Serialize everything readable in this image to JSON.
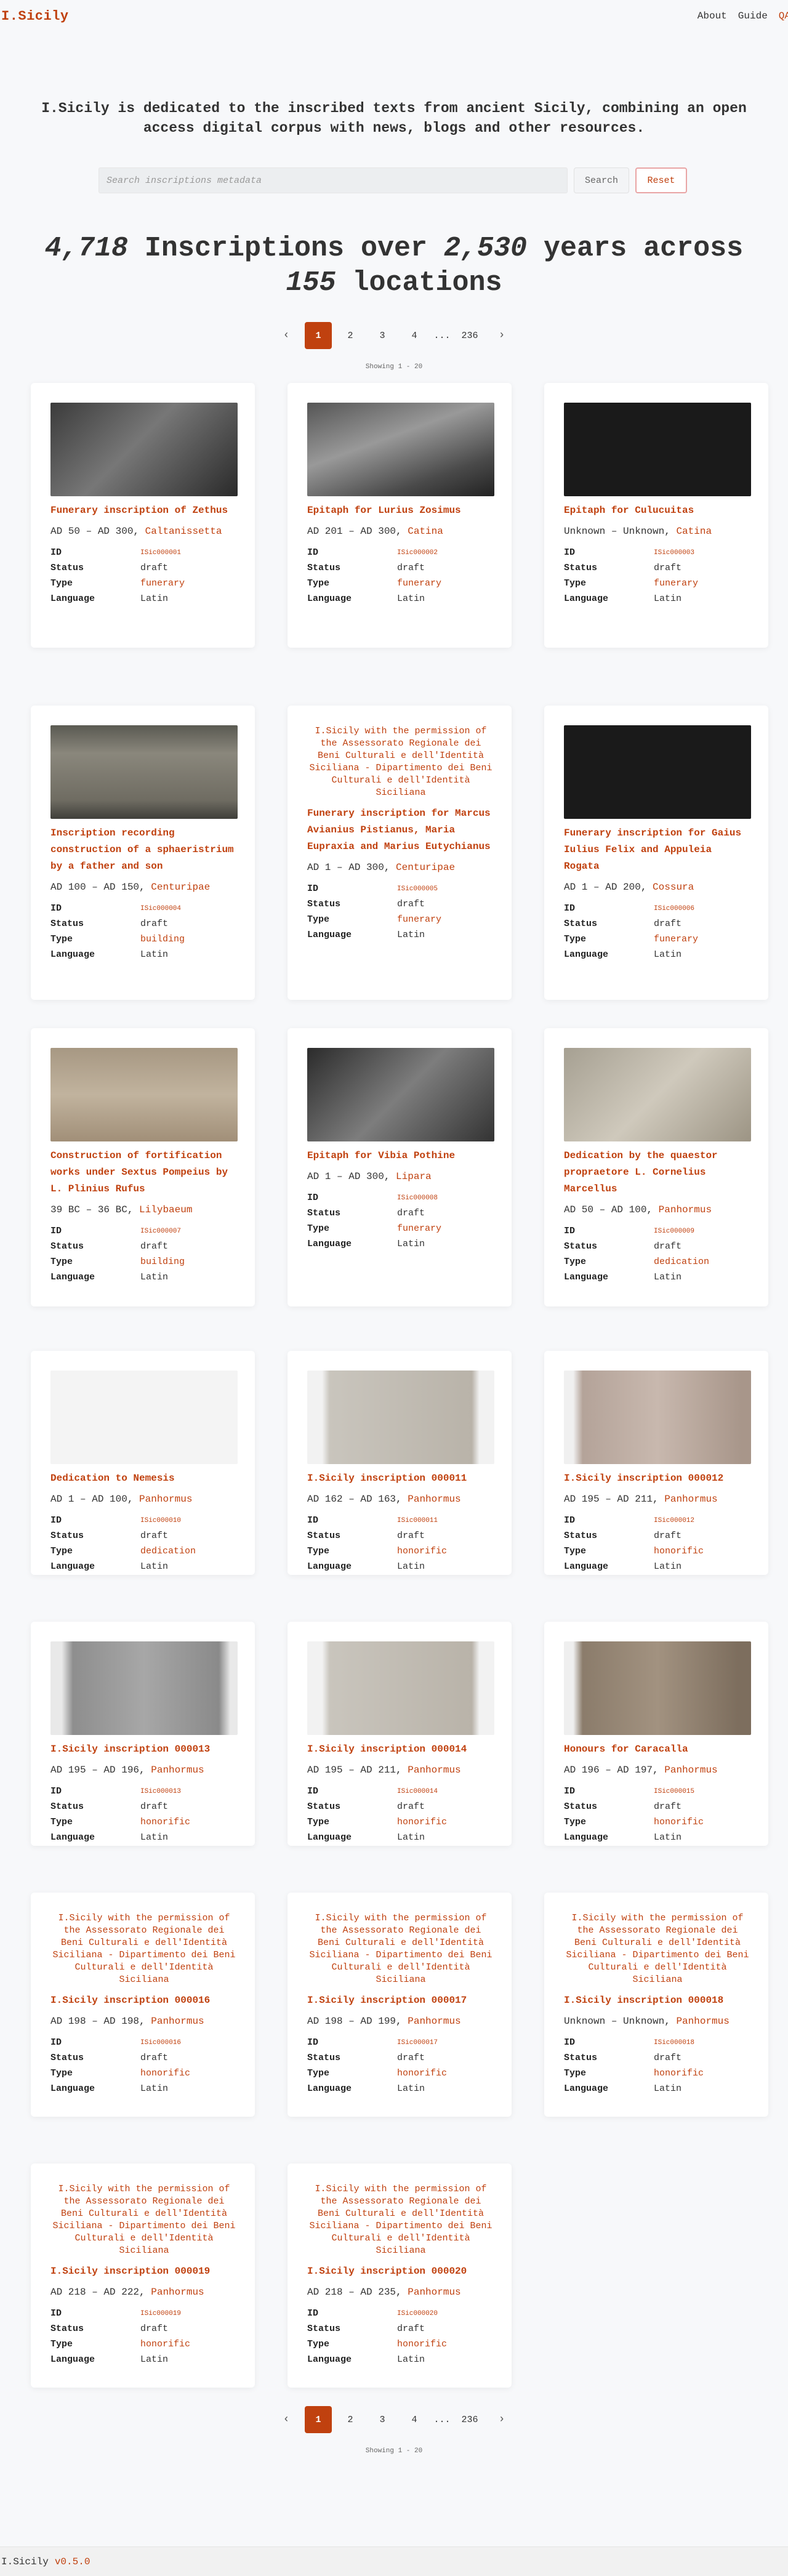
{
  "header": {
    "brand": "I.Sicily",
    "nav": {
      "about": "About",
      "guide": "Guide",
      "qa": "QA"
    }
  },
  "intro": "I.Sicily is dedicated to the inscribed texts from ancient Sicily, combining an open access digital corpus with news, blogs and other resources.",
  "search": {
    "placeholder": "Search inscriptions metadata",
    "search_label": "Search",
    "reset_label": "Reset"
  },
  "headline": {
    "count": "4,718",
    "middle": " Inscriptions over ",
    "years": "2,530",
    "middle2": " years across ",
    "locations": "155",
    "end": " locations"
  },
  "pagination": {
    "prev": "‹",
    "next": "›",
    "pages": [
      "1",
      "2",
      "3",
      "4"
    ],
    "dots": "...",
    "last": "236",
    "showing": "Showing 1 - 20"
  },
  "labels": {
    "id": "ID",
    "status": "Status",
    "type": "Type",
    "language": "Language"
  },
  "alt_text": "I.Sicily with the permission of the Assessorato Regionale dei Beni Culturali e dell'Identità Siciliana - Dipartimento dei Beni Culturali e dell'Identità Siciliana",
  "cards": [
    {
      "title": "Funerary inscription of Zethus",
      "date": "AD 50 – AD 300,",
      "place": "Caltanissetta",
      "id": "ISic000001",
      "status": "draft",
      "type": "funerary",
      "language": "Latin",
      "image": "stone-dark-letters"
    },
    {
      "title": "Epitaph for Lurius Zosimus",
      "date": "AD 201 – AD 300,",
      "place": "Catina",
      "id": "ISic000002",
      "status": "draft",
      "type": "funerary",
      "language": "Latin",
      "image": "stone-dark-gray"
    },
    {
      "title": "Epitaph for Culucuitas",
      "date": "Unknown – Unknown,",
      "place": "Catina",
      "id": "ISic000003",
      "status": "draft",
      "type": "funerary",
      "language": "Latin",
      "image": "stone-white-on-black"
    },
    {
      "title": "Inscription recording construction of a sphaeristrium by a father and son",
      "date": "AD 100 – AD 150,",
      "place": "Centuripae",
      "id": "ISic000004",
      "status": "draft",
      "type": "building",
      "language": "Latin",
      "image": "stone-block-gray"
    },
    {
      "title": "Funerary inscription for Marcus Avianius Pistianus, Maria Eupraxia and Marius Eutychianus",
      "date": "AD 1 – AD 300,",
      "place": "Centuripae",
      "id": "ISic000005",
      "status": "draft",
      "type": "funerary",
      "language": "Latin",
      "image": ""
    },
    {
      "title": "Funerary inscription for Gaius Iulius Felix and Appuleia Rogata",
      "date": "AD 1 – AD 200,",
      "place": "Cossura",
      "id": "ISic000006",
      "status": "draft",
      "type": "funerary",
      "language": "Latin",
      "image": "stone-white-on-black"
    },
    {
      "title": "Construction of fortification works under Sextus Pompeius by L. Plinius Rufus",
      "date": "39 BC – 36 BC,",
      "place": "Lilybaeum",
      "id": "ISic000007",
      "status": "draft",
      "type": "building",
      "language": "Latin",
      "image": "stone-tan"
    },
    {
      "title": "Epitaph for Vibia Pothine",
      "date": "AD 1 – AD 300,",
      "place": "Lipara",
      "id": "ISic000008",
      "status": "draft",
      "type": "funerary",
      "language": "Latin",
      "image": "stone-bw-letters"
    },
    {
      "title": "Dedication by the quaestor propraetore L. Cornelius Marcellus",
      "date": "AD 50 – AD 100,",
      "place": "Panhormus",
      "id": "ISic000009",
      "status": "draft",
      "type": "dedication",
      "language": "Latin",
      "image": "stone-beige-letters"
    },
    {
      "title": "Dedication to Nemesis",
      "date": "AD 1 – AD 100,",
      "place": "Panhormus",
      "id": "ISic000010",
      "status": "draft",
      "type": "dedication",
      "language": "Latin",
      "image": "stone-fragment-white"
    },
    {
      "title": "I.Sicily inscription 000011",
      "date": "AD 162 – AD 163,",
      "place": "Panhormus",
      "id": "ISic000011",
      "status": "draft",
      "type": "honorific",
      "language": "Latin",
      "image": "stone-slab-light"
    },
    {
      "title": "I.Sicily inscription 000012",
      "date": "AD 195 – AD 211,",
      "place": "Panhormus",
      "id": "ISic000012",
      "status": "draft",
      "type": "honorific",
      "language": "Latin",
      "image": "stone-slab-pink"
    },
    {
      "title": "I.Sicily inscription 000013",
      "date": "AD 195 – AD 196,",
      "place": "Panhormus",
      "id": "ISic000013",
      "status": "draft",
      "type": "honorific",
      "language": "Latin",
      "image": "stone-slab-gray"
    },
    {
      "title": "I.Sicily inscription 000014",
      "date": "AD 195 – AD 211,",
      "place": "Panhormus",
      "id": "ISic000014",
      "status": "draft",
      "type": "honorific",
      "language": "Latin",
      "image": "stone-slab-light"
    },
    {
      "title": "Honours for Caracalla",
      "date": "AD 196 – AD 197,",
      "place": "Panhormus",
      "id": "ISic000015",
      "status": "draft",
      "type": "honorific",
      "language": "Latin",
      "image": "stone-slab-brown"
    },
    {
      "title": "I.Sicily inscription 000016",
      "date": "AD 198 – AD 198,",
      "place": "Panhormus",
      "id": "ISic000016",
      "status": "draft",
      "type": "honorific",
      "language": "Latin",
      "image": ""
    },
    {
      "title": "I.Sicily inscription 000017",
      "date": "AD 198 – AD 199,",
      "place": "Panhormus",
      "id": "ISic000017",
      "status": "draft",
      "type": "honorific",
      "language": "Latin",
      "image": ""
    },
    {
      "title": "I.Sicily inscription 000018",
      "date": "Unknown – Unknown,",
      "place": "Panhormus",
      "id": "ISic000018",
      "status": "draft",
      "type": "honorific",
      "language": "Latin",
      "image": ""
    },
    {
      "title": "I.Sicily inscription 000019",
      "date": "AD 218 – AD 222,",
      "place": "Panhormus",
      "id": "ISic000019",
      "status": "draft",
      "type": "honorific",
      "language": "Latin",
      "image": ""
    },
    {
      "title": "I.Sicily inscription 000020",
      "date": "AD 218 – AD 235,",
      "place": "Panhormus",
      "id": "ISic000020",
      "status": "draft",
      "type": "honorific",
      "language": "Latin",
      "image": ""
    }
  ],
  "footer": {
    "brand": "I.Sicily",
    "version": "v0.5.0"
  },
  "colors": {
    "accent": "#c0410f",
    "background": "#f7f8fa"
  }
}
